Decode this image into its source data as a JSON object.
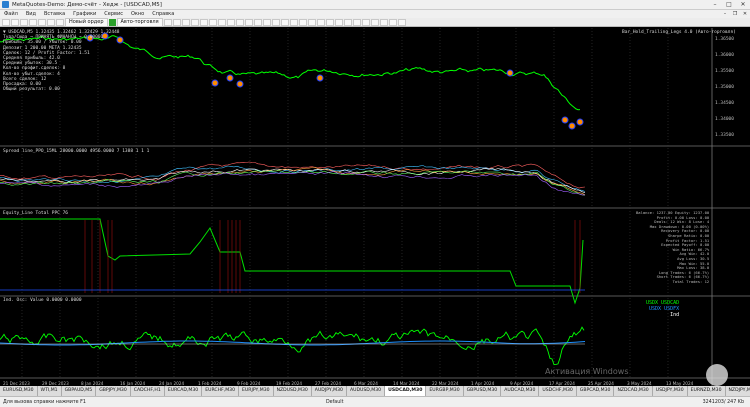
{
  "window": {
    "title": "MetaQuotes-Demo: Демо-счёт - Хедж - [USDCAD,M5]"
  },
  "menu": [
    "Файл",
    "Вид",
    "Вставка",
    "Графики",
    "Сервис",
    "Окно",
    "Справка"
  ],
  "toolbar": {
    "new_order": "Новый ордер",
    "autotrading": "Авто-торговля"
  },
  "price_panel": {
    "lines": [
      "▼ USDCAD,M5 1.32435 1.32462 1.32429 1.32448",
      "Туда/Сюда → ПРИНЯТЬ ФИНАНСЫ ~ 0.00001",
      "Прибыль: 35.00 / Убыток: 0.00",
      "Депозит 1 200.00 МЕТА 1.32435",
      "Сделок: 12 / Profit Factor: 1.51",
      "Средняя прибыль: 42.0",
      "Средний убыток: 30.5",
      "Кол-во профит.сделок: 8",
      "Кол-во убыт.сделок: 4",
      "Всего сделок: 12",
      "Просадка: 0.00",
      "Общий результат: 0.00"
    ],
    "right_label": "Bar_Hold_Trailing_Legs 4.0 (Авто-торговля)"
  },
  "subwindow1": {
    "label": "Spread line_PPO_15ML 28000.0000 4956.0000 7 1388 1 1 1"
  },
  "subwindow2": {
    "label": "Equity_Line Total PPC 76",
    "info_lines": [
      "Balance: 1237.00 Equity: 1237.00",
      "Profit: 0.00 Loss: 0.00",
      "Deals: 12 Win: 8 Lose: 4",
      "Max Drawdown: 0.00 (0.00%)",
      "Recovery Factor: 0.00",
      "Sharpe Ratio: 0.00",
      "Profit Factor: 1.51",
      "Expected Payoff: 0.00",
      "Win Ratio: 66.7%",
      "Avg Win: 42.0",
      "Avg Loss: 30.5",
      "Max Win: 55.0",
      "Max Loss: 38.0",
      "Long Trades: 6 (66.7%)",
      "Short Trades: 6 (66.7%)",
      "Total Trades: 12"
    ]
  },
  "subwindow3": {
    "label": "Ind. Osc: Value 0.0000 0.0000",
    "legend": [
      "USDX USDCAD",
      "USDX USDFX",
      "Ind"
    ],
    "legend_colors": [
      "#00ff00",
      "#1e90ff",
      "#ffffff"
    ]
  },
  "time_axis": [
    "21 Dec 2023",
    "29 Dec 2023",
    "8 Jan 2024",
    "16 Jan 2024",
    "24 Jan 2024",
    "1 Feb 2024",
    "9 Feb 2024",
    "19 Feb 2024",
    "27 Feb 2024",
    "6 Mar 2024",
    "14 Mar 2024",
    "22 Mar 2024",
    "1 Apr 2024",
    "9 Apr 2024",
    "17 Apr 2024",
    "25 Apr 2024",
    "3 May 2024",
    "13 May 2024"
  ],
  "price_axis": [
    "1.36500",
    "1.36000",
    "1.35500",
    "1.35000",
    "1.34500",
    "1.34000",
    "1.33500"
  ],
  "tabs": [
    "EURUSD,M30",
    "WTI,M1",
    "GBPAUD,M5",
    "GBPJPY,M30",
    "CADCHF,H1",
    "EURCAD,M30",
    "EURCHF,M30",
    "EURJPY,M30",
    "NZDUSD,M30",
    "AUDJPY,M30",
    "AUDUSD,M30",
    "USDCAD,M30",
    "EURGBP,M30",
    "GBPUSD,M30",
    "AUDCAD,M30",
    "USDCHF,M30",
    "GBPCAD,M30",
    "NZDCAD,M30",
    "USDJPY,M30",
    "EURNZD,M30",
    "NZDJPY,M30"
  ],
  "active_tab": "USDCAD,M30",
  "status": {
    "left": "Для вызова справки нажмите F1",
    "mid": "Default",
    "right": "3241203/ 247 Kb"
  },
  "watermark": "Активация Windows",
  "colors": {
    "background": "#000000",
    "price": "#00ff00",
    "grid": "#555555",
    "accent_tab": "#ffffff"
  }
}
